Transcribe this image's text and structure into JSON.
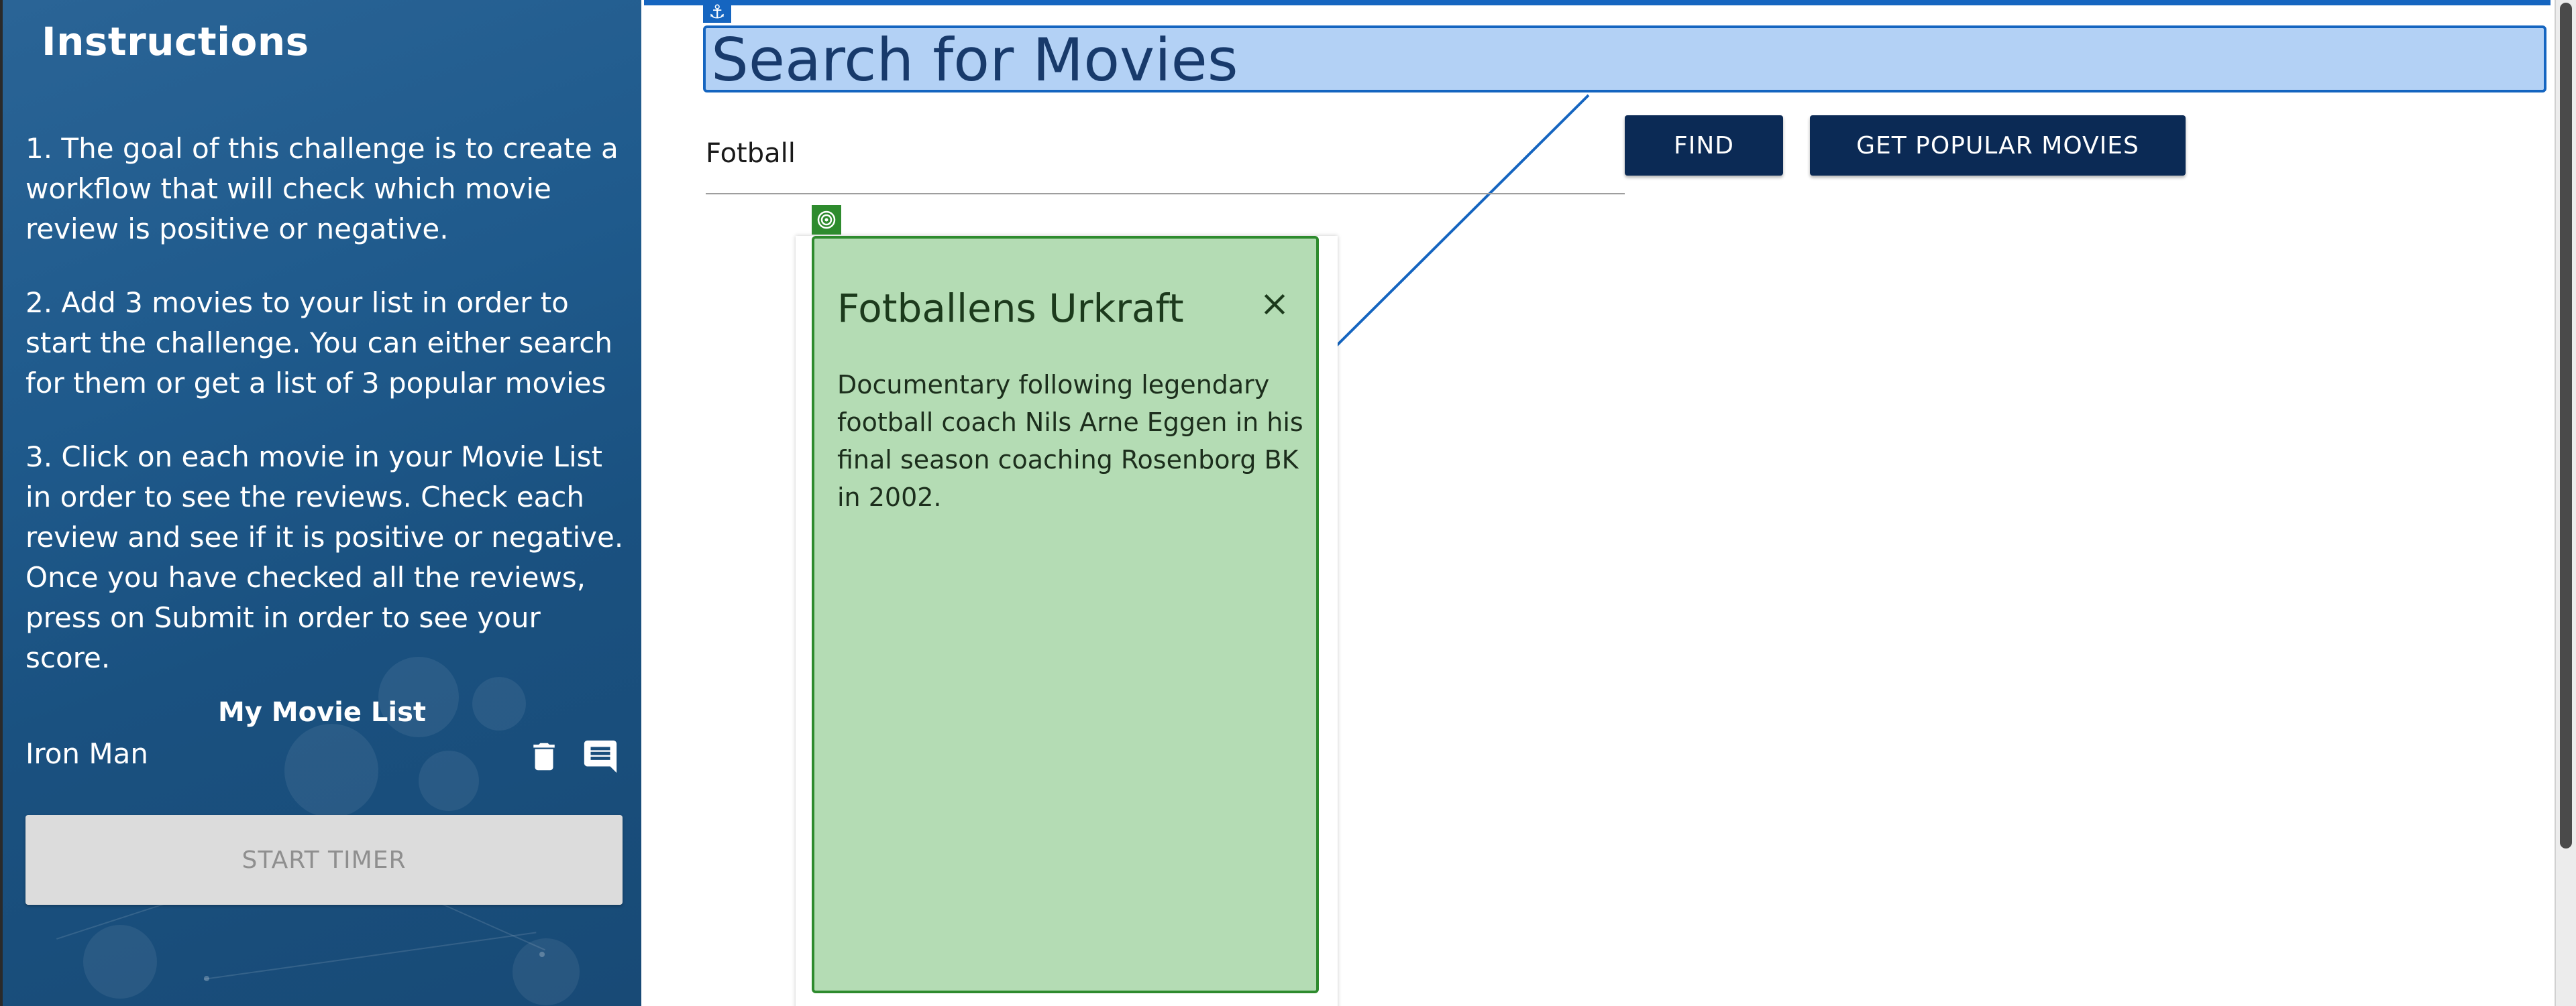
{
  "sidebar": {
    "title": "Instructions",
    "instructions": [
      "1. The goal of this challenge is to create a workflow that will check which movie review is positive or negative.",
      "2. Add 3 movies to your list in order to start the challenge. You can either search for them or get a list of 3 popular movies",
      "3. Click on each movie in your Movie List in order to see the reviews. Check each review and see if it is positive or negative. Once you have checked all the reviews, press on Submit in order to see your score."
    ],
    "movie_list_title": "My Movie List",
    "movies": [
      {
        "name": "Iron Man",
        "delete_icon": "trash-icon",
        "reviews_icon": "comment-icon"
      }
    ],
    "start_timer_label": "START TIMER",
    "start_timer_disabled": true
  },
  "main": {
    "heading": "Search for Movies",
    "search": {
      "value": "Fotball",
      "placeholder": ""
    },
    "find_label": "FIND",
    "popular_label": "GET POPULAR MOVIES",
    "result_card": {
      "title": "Fotballens Urkraft",
      "description": "Documentary following legendary football coach Nils Arne Eggen in his final season coaching Rosenborg BK in 2002.",
      "close_icon": "close-icon"
    }
  },
  "overlay": {
    "anchor_icon": "anchor-icon",
    "target_icon": "target-icon",
    "highlight_color": "#1565c0",
    "card_highlight_color": "#2e8b2e"
  },
  "colors": {
    "sidebar_bg": "#1f5a8c",
    "button_bg": "#0b2a55",
    "disabled_button_bg": "#dcdcdc"
  }
}
